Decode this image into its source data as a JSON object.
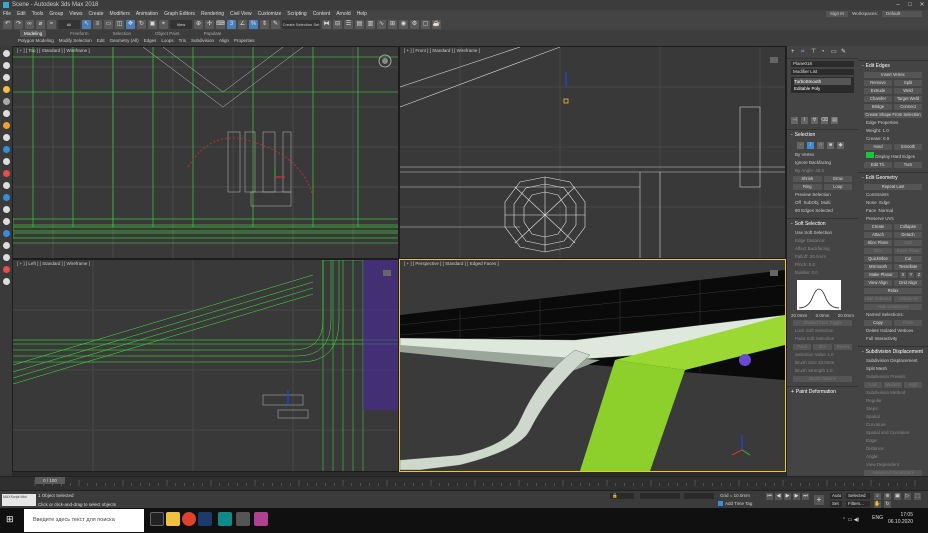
{
  "window": {
    "title": "Scene - Autodesk 3ds Max 2018"
  },
  "menu": [
    "File",
    "Edit",
    "Tools",
    "Group",
    "Views",
    "Create",
    "Modifiers",
    "Animation",
    "Graph Editors",
    "Rendering",
    "Civil View",
    "Customize",
    "Scripting",
    "Content",
    "Arnold",
    "Help"
  ],
  "menu_right": {
    "user": "Sign In",
    "workspaces_label": "Workspaces:",
    "workspace": "Default"
  },
  "toolbar": {
    "filter": "All",
    "view": "View",
    "create_selection_set": "Create Selection Set"
  },
  "ribbon": {
    "tabs": [
      "Modeling",
      "Freeform",
      "Selection",
      "Object Paint",
      "Populate"
    ],
    "active_tab": "Modeling",
    "sub": [
      "Polygon Modeling",
      "Modify Selection",
      "Edit",
      "Geometry (All)",
      "Edges",
      "Loops",
      "Tris",
      "Subdivision",
      "Align",
      "Properties"
    ]
  },
  "viewports": {
    "top_left": "[ + ] [ Top ] [ Standard ] [ Wireframe ]",
    "top_right": "[ + ] [ Front ] [ Standard ] [ Wireframe ]",
    "bottom_left": "[ + ] [ Left ] [ Standard ] [ Wireframe ]",
    "bottom_right": "[ + ] [ Perspective ] [ Standard ] [ Edged Faces ]"
  },
  "command_panel": {
    "object_name": "Plane018",
    "modifier_list": "Modifier List",
    "stack": [
      "TurboSmooth",
      "Editable Poly"
    ],
    "selection_title": "Selection",
    "by_vertex": "By Vertex",
    "ignore_backfacing": "Ignore Backfacing",
    "by_angle": "By Angle:",
    "by_angle_value": "45.0",
    "shrink": "Shrink",
    "grow": "Grow",
    "ring": "Ring",
    "loop": "Loop",
    "preview_selection": "Preview Selection",
    "preview_off": "Off",
    "preview_subobj": "SubObj",
    "preview_multi": "Multi",
    "selected_info": "80 Edges Selected",
    "soft_selection_title": "Soft Selection",
    "use_soft_selection": "Use Soft Selection",
    "edge_distance": "Edge Distance:",
    "affect_backfacing": "Affect Backfacing",
    "falloff": "Falloff:",
    "falloff_value": "20.0mm",
    "pinch": "Pinch:",
    "pinch_value": "0.0",
    "bubble": "Bubble:",
    "bubble_value": "0.0",
    "curve_labels": [
      "20.0mm",
      "0.0mm",
      "20.0mm"
    ],
    "shaded_face_toggle": "Shaded Face Toggle",
    "lock_soft_selection": "Lock Soft Selection",
    "paint_soft_selection": "Paint Soft Selection",
    "paint": "Paint",
    "blur": "Blur",
    "revert": "Revert",
    "selection_value": "Selection Value",
    "selection_value_num": "1.0",
    "brush_size": "Brush Size",
    "brush_size_num": "20.0mm",
    "brush_strength": "Brush Strength",
    "brush_strength_num": "1.0",
    "brush_options": "Brush Options",
    "paint_deformation_title": "Paint Deformation"
  },
  "command_panel_right": {
    "edit_edges_title": "Edit Edges",
    "insert_vertex": "Insert Vertex",
    "remove": "Remove",
    "split": "Split",
    "extrude": "Extrude",
    "weld": "Weld",
    "chamfer": "Chamfer",
    "target_weld": "Target Weld",
    "bridge": "Bridge",
    "connect": "Connect",
    "create_shape": "Create Shape From Selection",
    "edge_properties": "Edge Properties",
    "weight": "Weight:",
    "weight_value": "1.0",
    "crease": "Crease:",
    "crease_value": "0.0",
    "hard": "Hard",
    "smooth": "Smooth",
    "display_hard_edges": "Display Hard Edges",
    "edit_tri": "Edit Tri.",
    "turn": "Turn",
    "edit_geometry_title": "Edit Geometry",
    "repeat_last": "Repeat Last",
    "constraints": "Constraints",
    "c_none": "None",
    "c_edge": "Edge",
    "c_face": "Face",
    "c_normal": "Normal",
    "preserve_uvs": "Preserve UVs",
    "create": "Create",
    "collapse": "Collapse",
    "attach": "Attach",
    "detach": "Detach",
    "slice_plane": "Slice Plane",
    "split2": "Split",
    "slice": "Slice",
    "reset_plane": "Reset Plane",
    "quickslice": "QuickSlice",
    "cut": "Cut",
    "msmooth": "MSmooth",
    "tessellate": "Tessellate",
    "make_planar": "Make Planar",
    "x": "X",
    "y": "Y",
    "z": "Z",
    "view_align": "View Align",
    "grid_align": "Grid Align",
    "relax": "Relax",
    "hide_selected": "Hide Selected",
    "unhide_all": "Unhide All",
    "hide_unselected": "Hide Unselected",
    "named_selections": "Named Selections:",
    "copy": "Copy",
    "paste": "Paste",
    "delete_isolated": "Delete Isolated Vertices",
    "full_interactivity": "Full Interactivity",
    "subdivision_title": "Subdivision Displacement",
    "subdivision_displacement": "Subdivision Displacement",
    "split_mesh": "Split Mesh",
    "subdivision_presets": "Subdivision Presets",
    "low": "Low",
    "medium": "Medium",
    "high": "High",
    "subdivision_method": "Subdivision Method",
    "regular": "Regular",
    "steps": "Steps:",
    "spatial": "Spatial",
    "curvature": "Curvature",
    "spatial_and_curvature": "Spatial and Curvature",
    "edge": "Edge:",
    "distance": "Distance:",
    "angle": "Angle:",
    "view_dependent": "View Dependent",
    "advanced_params": "Advanced Parameters"
  },
  "timeline": {
    "frame": "0 / 100"
  },
  "status": {
    "objects_selected": "1 Object Selected",
    "prompt": "Click or click-and-drag to select objects",
    "grid": "Grid = 10.0mm",
    "add_time_tag": "Add Time Tag",
    "auto": "Auto",
    "set_k": "Set K.",
    "selected": "Selected",
    "filters": "Filters..."
  },
  "maxscript": "MAXScript Mini",
  "taskbar": {
    "search_placeholder": "Введите здесь текст для поиска",
    "lang": "ENG",
    "time": "17:05",
    "date": "06.10.2020"
  },
  "colors": {
    "wire_green": "#3cff3c",
    "mesh_green": "#7fc42a",
    "bg": "#393939",
    "active_border": "#e9c545"
  }
}
